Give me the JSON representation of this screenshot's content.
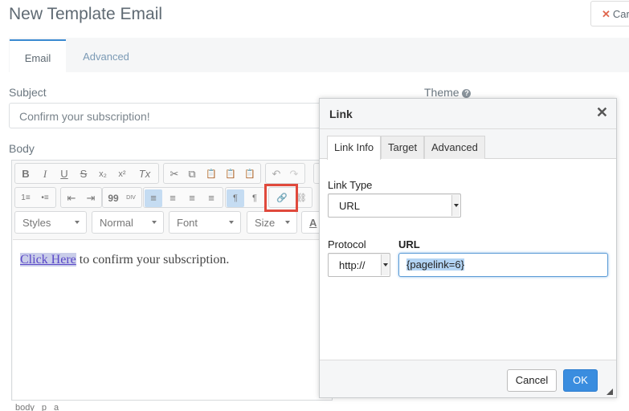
{
  "header": {
    "title": "New Template Email",
    "cancel_label": "Car"
  },
  "tabs": [
    {
      "label": "Email"
    },
    {
      "label": "Advanced"
    }
  ],
  "form": {
    "subject_label": "Subject",
    "subject_value": "Confirm your subscription!",
    "theme_label": "Theme",
    "body_label": "Body"
  },
  "toolbar": {
    "row1": [
      "B",
      "I",
      "U",
      "S",
      "x₂",
      "x²",
      "Tx",
      "✂",
      "⧉",
      "📋",
      "📋",
      "📋",
      "↶",
      "↷"
    ],
    "row2": [
      "1≡",
      "•≡",
      "⇤",
      "⇥",
      "99",
      "DIV",
      "≡",
      "≡",
      "≡",
      "≡",
      "¶",
      "¶",
      "🔗",
      "⛓"
    ],
    "styles": "Styles",
    "format": "Normal",
    "font": "Font",
    "size": "Size",
    "text_color": "A"
  },
  "editor": {
    "link_text": "Click Here",
    "rest_text": " to confirm your subscription.",
    "path": [
      "body",
      "p",
      "a"
    ]
  },
  "dialog": {
    "title": "Link",
    "tabs": [
      "Link Info",
      "Target",
      "Advanced"
    ],
    "link_type_label": "Link Type",
    "link_type_value": "URL",
    "protocol_label": "Protocol",
    "protocol_value": "http://",
    "url_label": "URL",
    "url_value": "{pagelink=6}",
    "cancel_label": "Cancel",
    "ok_label": "OK"
  },
  "colors": {
    "accent": "#3a8ddf",
    "highlight": "#e0493c"
  }
}
